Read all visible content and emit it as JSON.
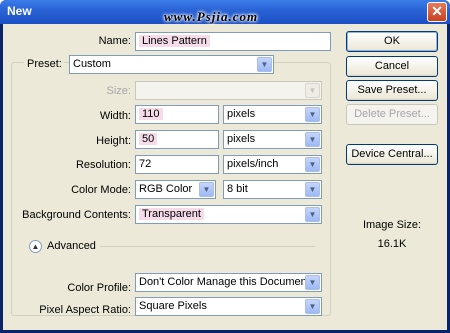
{
  "window": {
    "title": "New",
    "watermark": "www.Psjia.com",
    "close_glyph": "✕"
  },
  "form": {
    "name": {
      "label": "Name:",
      "value": "Lines Pattern"
    },
    "preset": {
      "label": "Preset:",
      "value": "Custom"
    },
    "size": {
      "label": "Size:",
      "value": ""
    },
    "width": {
      "label": "Width:",
      "value": "110",
      "unit": "pixels"
    },
    "height": {
      "label": "Height:",
      "value": "50",
      "unit": "pixels"
    },
    "resolution": {
      "label": "Resolution:",
      "value": "72",
      "unit": "pixels/inch"
    },
    "color_mode": {
      "label": "Color Mode:",
      "value": "RGB Color",
      "depth": "8 bit"
    },
    "background": {
      "label": "Background Contents:",
      "value": "Transparent"
    },
    "advanced": {
      "label": "Advanced",
      "icon": "chevron-up-circle-icon"
    },
    "color_profile": {
      "label": "Color Profile:",
      "value": "Don't Color Manage this Document"
    },
    "pixel_aspect": {
      "label": "Pixel Aspect Ratio:",
      "value": "Square Pixels"
    }
  },
  "buttons": {
    "ok": "OK",
    "cancel": "Cancel",
    "save_preset": "Save Preset...",
    "delete_preset": "Delete Preset...",
    "device_central": "Device Central..."
  },
  "info": {
    "image_size_label": "Image Size:",
    "image_size_value": "16.1K"
  },
  "dropdown_arrow": "▼",
  "colors": {
    "titlebar": "#2a64d6",
    "dialog_bg": "#ece9d8",
    "field_highlight": "#f6dbe8"
  }
}
